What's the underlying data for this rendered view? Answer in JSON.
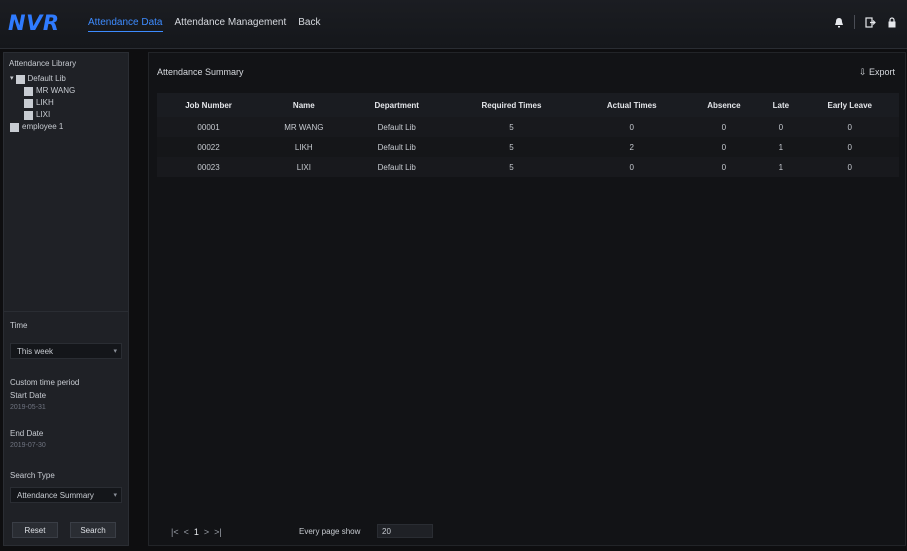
{
  "app": {
    "logo": "NVR"
  },
  "nav": {
    "items": [
      "Attendance Data",
      "Attendance Management",
      "Back"
    ]
  },
  "topbar": {
    "icons": [
      "bell-icon",
      "logout-icon",
      "lock-icon"
    ]
  },
  "sidebar": {
    "library_title": "Attendance Library",
    "tree": [
      {
        "label": "Default Lib",
        "level": 1,
        "expand": "▾"
      },
      {
        "label": "MR WANG",
        "level": 2
      },
      {
        "label": "LIKH",
        "level": 2
      },
      {
        "label": "LIXI",
        "level": 2
      },
      {
        "label": "employee 1",
        "level": 1
      }
    ],
    "time_label": "Time",
    "time_value": "This week",
    "custom_label": "Custom time period",
    "start_label": "Start Date",
    "start_value": "2019-05-31",
    "end_label": "End Date",
    "end_value": "2019-07-30",
    "search_type_label": "Search Type",
    "search_type_value": "Attendance Summary",
    "reset_label": "Reset",
    "search_label": "Search"
  },
  "panel": {
    "title": "Attendance Summary",
    "export_label": "⇩ Export",
    "columns": [
      "Job Number",
      "Name",
      "Department",
      "Required Times",
      "Actual Times",
      "Absence",
      "Late",
      "Early Leave"
    ],
    "rows": [
      [
        "00001",
        "MR WANG",
        "Default Lib",
        "5",
        "0",
        "0",
        "0",
        "0"
      ],
      [
        "00022",
        "LIKH",
        "Default Lib",
        "5",
        "2",
        "0",
        "1",
        "0"
      ],
      [
        "00023",
        "LIXI",
        "Default Lib",
        "5",
        "0",
        "0",
        "1",
        "0"
      ]
    ]
  },
  "pager": {
    "first": "|<",
    "prev": "<",
    "page": "1",
    "next": ">",
    "last": ">|",
    "per_page_label": "Every page show",
    "per_page_value": "20"
  }
}
